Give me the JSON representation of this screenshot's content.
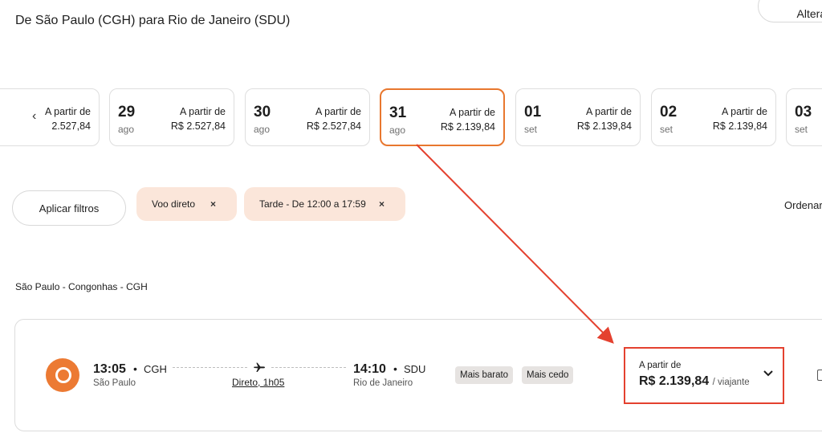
{
  "header": {
    "route_title": "De São Paulo (CGH) para Rio de Janeiro (SDU)",
    "change_search_label": "Alterar b"
  },
  "date_strip": {
    "prev_arrow": "‹",
    "dates": [
      {
        "day": "",
        "month": "",
        "from_label": "A partir de",
        "price": "2.527,84",
        "selected": false
      },
      {
        "day": "29",
        "month": "ago",
        "from_label": "A partir de",
        "price": "R$ 2.527,84",
        "selected": false
      },
      {
        "day": "30",
        "month": "ago",
        "from_label": "A partir de",
        "price": "R$ 2.527,84",
        "selected": false
      },
      {
        "day": "31",
        "month": "ago",
        "from_label": "A partir de",
        "price": "R$ 2.139,84",
        "selected": true
      },
      {
        "day": "01",
        "month": "set",
        "from_label": "A partir de",
        "price": "R$ 2.139,84",
        "selected": false
      },
      {
        "day": "02",
        "month": "set",
        "from_label": "A partir de",
        "price": "R$ 2.139,84",
        "selected": false
      },
      {
        "day": "03",
        "month": "set",
        "from_label": "",
        "price": "",
        "selected": false
      }
    ]
  },
  "filters": {
    "apply_label": "Aplicar filtros",
    "chips": [
      {
        "label": "Voo direto",
        "remove": "×"
      },
      {
        "label": "Tarde - De 12:00 a 17:59",
        "remove": "×"
      }
    ],
    "sort_label": "Ordenar"
  },
  "section": {
    "origin_airport": "São Paulo - Congonhas - CGH"
  },
  "flight": {
    "airline_icon": "airline-logo-icon",
    "departure_time": "13:05",
    "departure_code": "CGH",
    "departure_city": "São Paulo",
    "separator": "•",
    "duration": "Direto, 1h05",
    "arrival_time": "14:10",
    "arrival_code": "SDU",
    "arrival_city": "Rio de Janeiro",
    "badges": [
      "Mais barato",
      "Mais cedo"
    ],
    "price_from": "A partir de",
    "price": "R$ 2.139,84",
    "per_traveler": "/ viajante"
  },
  "colors": {
    "accent": "#e8772e",
    "chip_bg": "#fbe6da",
    "annotation": "#e4412f",
    "airline": "#ec7a33"
  }
}
